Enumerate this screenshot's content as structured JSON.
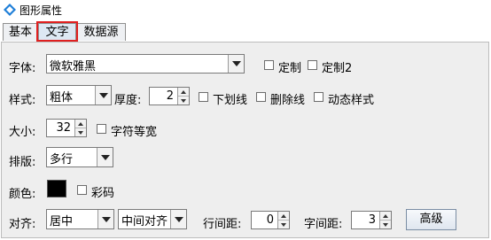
{
  "window": {
    "title": "图形属性",
    "icon": "diamond-app-icon"
  },
  "tabs": [
    {
      "label": "基本",
      "active": false
    },
    {
      "label": "文字",
      "active": true
    },
    {
      "label": "数据源",
      "active": false
    }
  ],
  "font": {
    "label": "字体:",
    "value": "微软雅黑",
    "custom_label": "定制",
    "custom2_label": "定制2"
  },
  "style": {
    "label": "样式:",
    "value": "粗体",
    "thickness_label": "厚度:",
    "thickness_value": "2",
    "underline_label": "下划线",
    "strikethrough_label": "删除线",
    "dynamic_label": "动态样式"
  },
  "size": {
    "label": "大小:",
    "value": "32",
    "equal_width_label": "字符等宽"
  },
  "layout": {
    "label": "排版:",
    "value": "多行"
  },
  "color": {
    "label": "颜色:",
    "swatch": "#000000",
    "color_code_label": "彩码"
  },
  "align": {
    "label": "对齐:",
    "horizontal": "居中",
    "vertical": "中间对齐",
    "line_spacing_label": "行间距:",
    "line_spacing_value": "0",
    "char_spacing_label": "字间距:",
    "char_spacing_value": "3",
    "advanced_label": "高级"
  },
  "colors": {
    "highlight": "#e02020",
    "panel_bg": "#eeeeee",
    "app_icon": "#1f7fd8"
  }
}
